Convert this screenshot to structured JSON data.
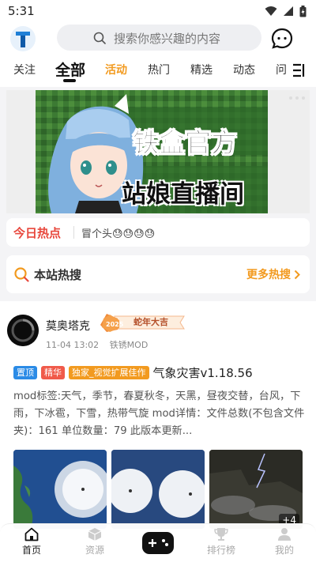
{
  "status": {
    "time": "5:31"
  },
  "search": {
    "placeholder": "搜索你感兴趣的内容"
  },
  "tabs": [
    {
      "label": "关注"
    },
    {
      "label": "全部"
    },
    {
      "label": "活动"
    },
    {
      "label": "热门"
    },
    {
      "label": "精选"
    },
    {
      "label": "动态"
    },
    {
      "label": "问"
    }
  ],
  "banner": {
    "line1": "铁盒官方",
    "line2": "站娘直播间"
  },
  "hot_today": {
    "label": "今日热点",
    "text": "冒个头😓😓😓😓"
  },
  "site_hot": {
    "title": "本站热搜",
    "more": "更多热搜"
  },
  "post": {
    "username": "莫奥塔克",
    "badge": "蛇年大吉",
    "time": "11-04 13:02",
    "source": "铁锈MOD",
    "tags": [
      "置顶",
      "精华",
      "独家_视觉扩展佳作"
    ],
    "title": "气象灾害v1.18.56",
    "body": "mod标签:天气，季节，春夏秋冬，天黑，昼夜交替，台风，下雨，下冰雹，下雪，热带气旋 mod详情：文件总数(不包含文件夹)：161 单位数量：79 此版本更新...",
    "extra_images": "+4"
  },
  "bottom_nav": [
    {
      "label": "首页"
    },
    {
      "label": "资源"
    },
    {
      "label": "排行榜"
    },
    {
      "label": "我的"
    }
  ],
  "colors": {
    "accent": "#f29a1f",
    "hot": "#e8473c",
    "tag_top": "#2b8be6"
  }
}
